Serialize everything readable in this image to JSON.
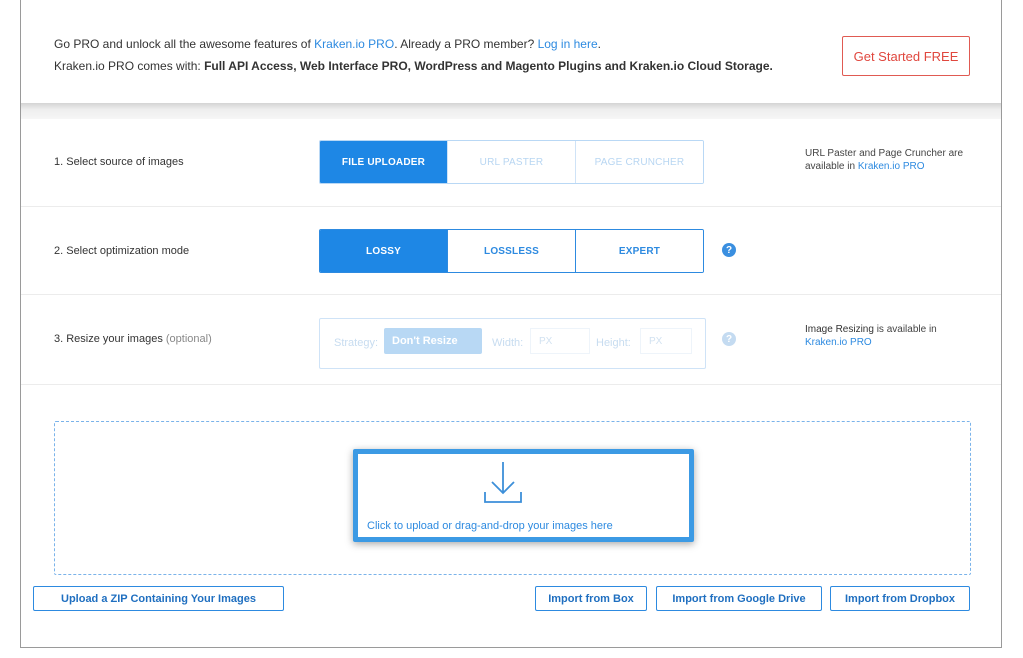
{
  "banner": {
    "line1_prefix": "Go PRO and unlock all the awesome features of ",
    "line1_link": "Kraken.io PRO",
    "line1_middle": ". Already a PRO member? ",
    "line1_login": "Log in here",
    "line1_suffix": ".",
    "line2_prefix": "Kraken.io PRO comes with: ",
    "line2_bold": "Full API Access, Web Interface PRO, WordPress and Magento Plugins and Kraken.io Cloud Storage.",
    "cta_label": "Get Started FREE",
    "cta_color": "#e0473e"
  },
  "step1": {
    "label": "1. Select source of images",
    "options": [
      "FILE UPLOADER",
      "URL PASTER",
      "PAGE CRUNCHER"
    ],
    "selected": "FILE UPLOADER",
    "note_text": "URL Paster and Page Cruncher are available in ",
    "note_link": "Kraken.io PRO"
  },
  "step2": {
    "label": "2. Select optimization mode",
    "options": [
      "LOSSY",
      "LOSSLESS",
      "EXPERT"
    ],
    "selected": "LOSSY",
    "help_icon": "question-circle-icon",
    "help_glyph": "?"
  },
  "step3": {
    "label": "3. Resize your images",
    "label_optional": "(optional)",
    "strategy_label": "Strategy:",
    "strategy_value": "Don't Resize",
    "width_label": "Width:",
    "width_placeholder": "PX",
    "height_label": "Height:",
    "height_placeholder": "PX",
    "help_glyph": "?",
    "note_bold": "Image Resizing",
    "note_text": " is available in",
    "note_link": "Kraken.io PRO"
  },
  "dropzone": {
    "icon": "download-tray-icon",
    "text": "Click to upload or drag-and-drop your images here"
  },
  "imports": {
    "zip": "Upload a ZIP Containing Your Images",
    "box": "Import from Box",
    "gdrive": "Import from Google Drive",
    "dropbox": "Import from Dropbox"
  },
  "colors": {
    "accent": "#1e87e5",
    "link": "#2d8ae0",
    "highlight": "#3c9ae4"
  }
}
